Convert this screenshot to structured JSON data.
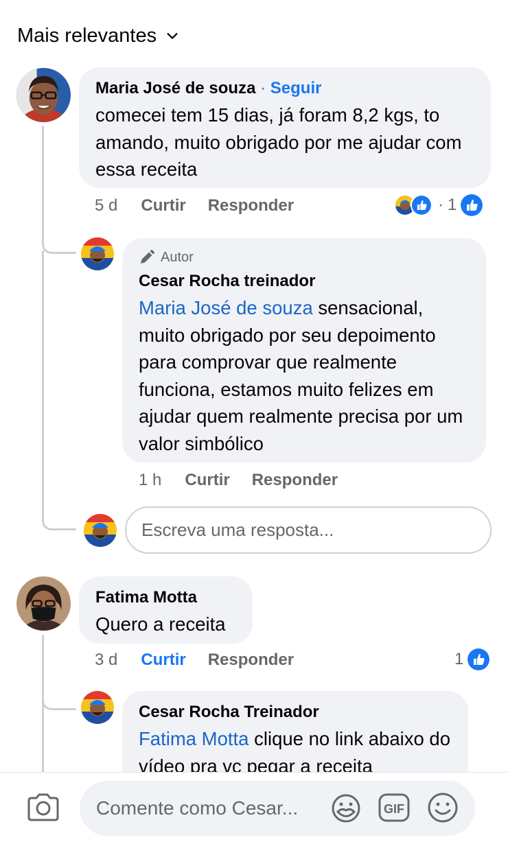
{
  "sort": {
    "label": "Mais relevantes"
  },
  "comments": [
    {
      "author": "Maria José de souza",
      "separator": "·",
      "follow": "Seguir",
      "text": "comecei tem 15 dias, já foram 8,2 kgs, to amando, muito obrigado por me ajudar com essa receita",
      "time": "5 d",
      "like": "Curtir",
      "reply": "Responder",
      "reaction_count": "1",
      "reaction_separator": "·",
      "reply_item": {
        "badge": "Autor",
        "author": "Cesar Rocha treinador",
        "mention": "Maria José de souza",
        "text": " sensacional, muito obrigado por seu depoimento para comprovar que realmente funciona, estamos muito felizes em ajudar quem realmente precisa por um valor simbólico",
        "time": "1 h",
        "like": "Curtir",
        "reply": "Responder"
      },
      "reply_placeholder": "Escreva uma resposta..."
    },
    {
      "author": "Fatima Motta",
      "text": "Quero a receita",
      "time": "3 d",
      "like": "Curtir",
      "reply": "Responder",
      "reaction_count": "1",
      "reply_item": {
        "author": "Cesar Rocha Treinador",
        "mention": "Fatima Motta",
        "text": " clique no link abaixo do vídeo pra vc pegar a receita"
      }
    }
  ],
  "composer": {
    "placeholder": "Comente como Cesar..."
  },
  "colors": {
    "accent": "#1877f2",
    "bubble": "#f0f2f5",
    "muted": "#65676b"
  },
  "icons": [
    "chevron-down-icon",
    "like-icon",
    "pencil-icon",
    "camera-icon",
    "sticker-icon",
    "gif-icon",
    "emoji-icon"
  ]
}
